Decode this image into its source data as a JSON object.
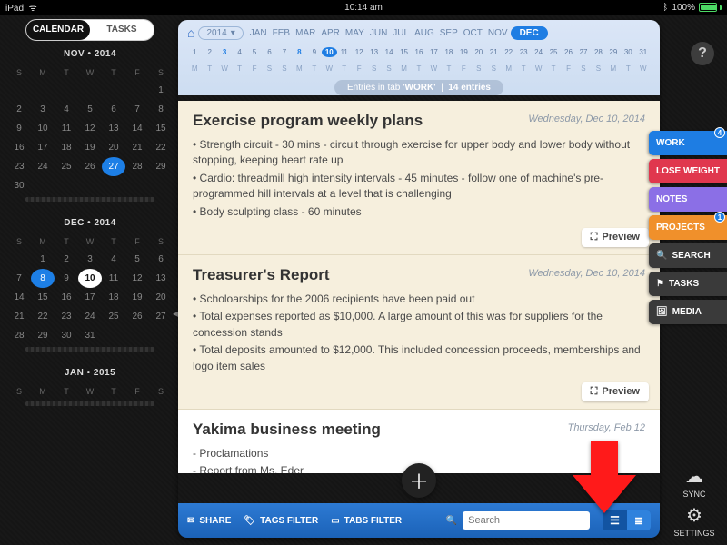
{
  "status": {
    "device": "iPad",
    "time": "10:14 am",
    "bt": "✳︎",
    "battery": "100%"
  },
  "sidebar": {
    "toggle": {
      "calendar": "CALENDAR",
      "tasks": "TASKS"
    },
    "weekhdr": [
      "S",
      "M",
      "T",
      "W",
      "T",
      "F",
      "S"
    ],
    "months": [
      {
        "title": "NOV • 2014",
        "rows": [
          [
            "",
            "",
            "",
            "",
            "",
            "",
            "1"
          ],
          [
            "2",
            "3",
            "4",
            "5",
            "6",
            "7",
            "8"
          ],
          [
            "9",
            "10",
            "11",
            "12",
            "13",
            "14",
            "15"
          ],
          [
            "16",
            "17",
            "18",
            "19",
            "20",
            "21",
            "22"
          ],
          [
            "23",
            "24",
            "25",
            "26",
            "27",
            "28",
            "29"
          ],
          [
            "30",
            "",
            "",
            "",
            "",
            "",
            ""
          ]
        ],
        "highlight": {
          "blue": [
            "27"
          ]
        }
      },
      {
        "title": "DEC • 2014",
        "rows": [
          [
            "",
            "1",
            "2",
            "3",
            "4",
            "5",
            "6"
          ],
          [
            "7",
            "8",
            "9",
            "10",
            "11",
            "12",
            "13"
          ],
          [
            "14",
            "15",
            "16",
            "17",
            "18",
            "19",
            "20"
          ],
          [
            "21",
            "22",
            "23",
            "24",
            "25",
            "26",
            "27"
          ],
          [
            "28",
            "29",
            "30",
            "31",
            "",
            "",
            ""
          ]
        ],
        "highlight": {
          "blue": [
            "8"
          ],
          "white": [
            "10"
          ]
        }
      },
      {
        "title": "JAN • 2015",
        "rows": [],
        "highlight": {}
      }
    ]
  },
  "header": {
    "year": "2014",
    "months": [
      "JAN",
      "FEB",
      "MAR",
      "APR",
      "MAY",
      "JUN",
      "JUL",
      "AUG",
      "SEP",
      "OCT",
      "NOV",
      "DEC"
    ],
    "selected_month": "DEC",
    "days_num": [
      "1",
      "2",
      "3",
      "4",
      "5",
      "6",
      "7",
      "8",
      "9",
      "10",
      "11",
      "12",
      "13",
      "14",
      "15",
      "16",
      "17",
      "18",
      "19",
      "20",
      "21",
      "22",
      "23",
      "24",
      "25",
      "26",
      "27",
      "28",
      "29",
      "30",
      "31"
    ],
    "days_letter": [
      "M",
      "T",
      "W",
      "T",
      "F",
      "S",
      "S",
      "M",
      "T",
      "W",
      "T",
      "F",
      "S",
      "S",
      "M",
      "T",
      "W",
      "T",
      "F",
      "S",
      "S",
      "M",
      "T",
      "W",
      "T",
      "F",
      "S",
      "S",
      "M",
      "T",
      "W"
    ],
    "bold_days": [
      "3",
      "8",
      "10"
    ],
    "today": "10",
    "crumb_pre": "Entries in tab",
    "crumb_tab": "'WORK'",
    "crumb_count": "14 entries"
  },
  "entries": [
    {
      "title": "Exercise program weekly plans",
      "date": "Wednesday, Dec 10, 2014",
      "lines": [
        "• Strength circuit - 30 mins - circuit through exercise for upper body and lower body without stopping, keeping heart rate up",
        "• Cardio: threadmill high intensity intervals -  45 minutes - follow one of machine's pre-programmed hill intervals at a level that is challenging",
        "•  Body sculpting class - 60 minutes"
      ],
      "preview": "Preview"
    },
    {
      "title": "Treasurer's Report",
      "date": "Wednesday, Dec 10, 2014",
      "lines": [
        "• Scholoarships for the 2006 recipients have been paid out",
        "• Total expenses reported as $10,000. A large amount of this was for suppliers for the concession stands",
        "• Total deposits amounted to $12,000. This included concession proceeds, memberships and logo item sales"
      ],
      "preview": "Preview"
    },
    {
      "title": "Yakima business meeting",
      "date": "Thursday, Feb 12",
      "lines": [
        "-  Proclamations",
        "-  Report from Ms. Eder"
      ],
      "preview": ""
    }
  ],
  "bottombar": {
    "share": "SHARE",
    "tags": "TAGS FILTER",
    "tabs": "TABS FILTER",
    "search_placeholder": "Search"
  },
  "righttabs": [
    {
      "label": "WORK",
      "color": "#1e7de3",
      "badge": "4"
    },
    {
      "label": "LOSE WEIGHT",
      "color": "#e0374e",
      "badge": ""
    },
    {
      "label": "NOTES",
      "color": "#8b6fe6",
      "badge": ""
    },
    {
      "label": "PROJECTS",
      "color": "#f0902b",
      "badge": "1"
    },
    {
      "label": "SEARCH",
      "color": "#3a3a3a",
      "icon": "🔍",
      "badge": ""
    },
    {
      "label": "TASKS",
      "color": "#3a3a3a",
      "icon": "⚑",
      "badge": ""
    },
    {
      "label": "MEDIA",
      "color": "#3a3a3a",
      "icon": "🖼",
      "badge": ""
    }
  ],
  "rightbottom": {
    "sync": "SYNC",
    "settings": "SETTINGS"
  },
  "help": "?"
}
